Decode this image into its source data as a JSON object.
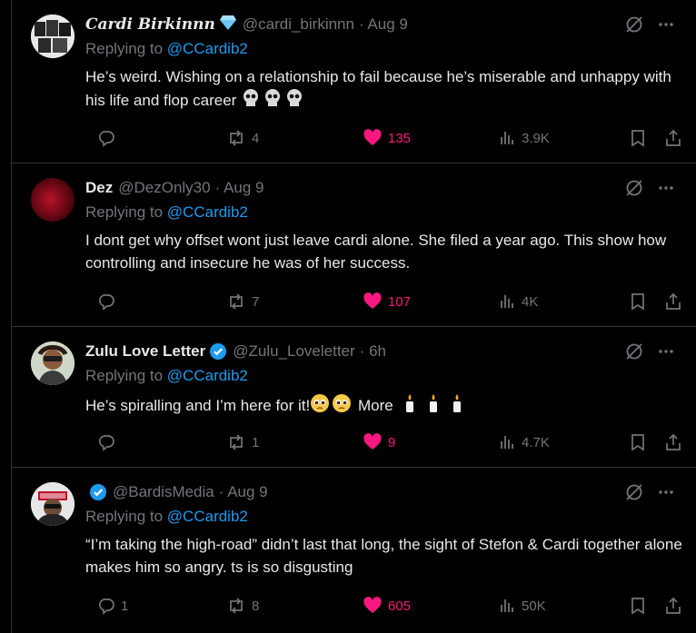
{
  "colors": {
    "background": "#000000",
    "text": "#e7e9ea",
    "muted": "#71767b",
    "link": "#1d9bf0",
    "like": "#f91880",
    "verified": "#1d9bf0"
  },
  "tweets": [
    {
      "name": "Cardi Birkinnn",
      "name_badge": "diamond-emoji",
      "handle": "@cardi_birkinnn",
      "time": "· Aug 9",
      "reply_prefix": "Replying to",
      "reply_to": "@CCardib2",
      "text": "He’s weird. Wishing on a relationship to fail because he’s miserable and unhappy with his life and flop career",
      "text_emoji": [
        "skull",
        "skull",
        "skull"
      ],
      "replies": "",
      "reposts": "4",
      "likes": "135",
      "views": "3.9K"
    },
    {
      "name": "Dez",
      "handle": "@DezOnly30",
      "time": "· Aug 9",
      "reply_prefix": "Replying to",
      "reply_to": "@CCardib2",
      "text": "I dont get why offset wont just leave cardi alone. She filed a year ago. This show how controlling and insecure he was of her success.",
      "replies": "",
      "reposts": "7",
      "likes": "107",
      "views": "4K"
    },
    {
      "name": "Zulu Love Letter",
      "name_badge": "verified-badge",
      "handle": "@Zulu_Loveletter",
      "time": "· 6h",
      "reply_prefix": "Replying to",
      "reply_to": "@CCardib2",
      "text": "He’s spiralling and I’m here for it!",
      "text_after": "More",
      "text_emoji": [
        "pleading-face",
        "pleading-face"
      ],
      "text_emoji_after": [
        "candle",
        "candle",
        "candle"
      ],
      "replies": "",
      "reposts": "1",
      "likes": "9",
      "views": "4.7K"
    },
    {
      "name": "",
      "name_badge": "verified-badge",
      "handle": "@BardisMedia",
      "time": "· Aug 9",
      "reply_prefix": "Replying to",
      "reply_to": "@CCardib2",
      "text": "“I’m taking the high-road” didn’t last that long, the sight of Stefon & Cardi together alone makes him so angry. ts is so disgusting",
      "replies": "1",
      "reposts": "8",
      "likes": "605",
      "views": "50K"
    }
  ]
}
